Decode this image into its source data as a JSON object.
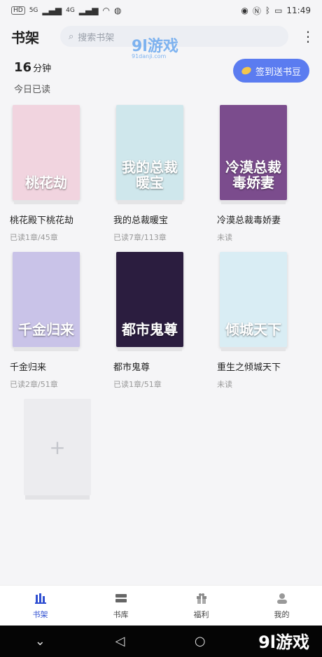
{
  "status_bar": {
    "left_badges": [
      "HD",
      "5G",
      "4G"
    ],
    "time": "11:49"
  },
  "header": {
    "title": "书架",
    "search_placeholder": "搜索书架"
  },
  "watermark": {
    "brand": "9l游戏",
    "site": "91danji.com"
  },
  "reading_stats": {
    "minutes": "16",
    "unit": "分钟",
    "label": "今日已读"
  },
  "checkin_button": "签到送书豆",
  "books": [
    {
      "title": "桃花殿下桃花劫",
      "progress": "已读1章/45章",
      "cover_text": "桃花劫",
      "cover_color": "#f1d4df"
    },
    {
      "title": "我的总裁暖宝",
      "progress": "已读7章/113章",
      "cover_text": "我的总裁暖宝",
      "cover_color": "#cfe7ec"
    },
    {
      "title": "冷漠总裁毒娇妻",
      "progress": "未读",
      "cover_text": "冷漠总裁毒娇妻",
      "cover_color": "#7b4c8d"
    },
    {
      "title": "千金归来",
      "progress": "已读2章/51章",
      "cover_text": "千金归来",
      "cover_color": "#c9c3e8"
    },
    {
      "title": "都市鬼尊",
      "progress": "已读1章/51章",
      "cover_text": "都市鬼尊",
      "cover_color": "#2b1d3f"
    },
    {
      "title": "重生之倾城天下",
      "progress": "未读",
      "cover_text": "倾城天下",
      "cover_color": "#d9edf4"
    }
  ],
  "add_slot_symbol": "+",
  "nav": [
    {
      "label": "书架",
      "icon": "bookshelf-icon",
      "active": true
    },
    {
      "label": "书库",
      "icon": "library-icon",
      "active": false
    },
    {
      "label": "福利",
      "icon": "gift-icon",
      "active": false
    },
    {
      "label": "我的",
      "icon": "profile-icon",
      "active": false
    }
  ],
  "system_nav": [
    "chevron-down-icon",
    "back-icon",
    "home-icon"
  ],
  "colors": {
    "accent": "#5b7cf0",
    "nav_active": "#2f4fd1",
    "background": "#f5f5f7"
  }
}
